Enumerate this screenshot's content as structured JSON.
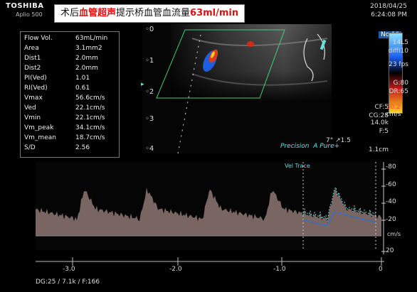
{
  "header": {
    "brand": "TOSHIBA",
    "model": "Aplio 500",
    "banner_prefix": "术后",
    "banner_highlight": "血管超声",
    "banner_middle": "提示桥血管血流量",
    "banner_value": "63ml/min",
    "date": "2018/04/25",
    "time": "6:24:08 PM"
  },
  "measurements": [
    {
      "label": "Flow Vol.",
      "value": "63mL/min"
    },
    {
      "label": "Area",
      "value": "3.1mm2"
    },
    {
      "label": "Dist1",
      "value": "2.0mm"
    },
    {
      "label": "Dist2",
      "value": "2.0mm"
    },
    {
      "label": "PI(Ved)",
      "value": "1.01"
    },
    {
      "label": "RI(Ved)",
      "value": "0.61"
    },
    {
      "label": "Vmax",
      "value": "56.6cm/s"
    },
    {
      "label": "Ved",
      "value": "22.1cm/s"
    },
    {
      "label": "Vmin",
      "value": "22.1cm/s"
    },
    {
      "label": "Vm_peak",
      "value": "34.1cm/s"
    },
    {
      "label": "Vm_mean",
      "value": "18.7cm/s"
    },
    {
      "label": "S/D",
      "value": "2.56"
    }
  ],
  "depth_marks": [
    "0",
    "1",
    "2",
    "3",
    "4"
  ],
  "color_bar": {
    "top": "No.16",
    "bottom_value": "30.2",
    "bottom_unit": "cm/s"
  },
  "params": [
    "14L5",
    "diffI10",
    "23 fps",
    "G:80",
    "DR:65",
    "CF:5",
    "CG:28",
    "14.0k",
    "F:5",
    "1.1cm"
  ],
  "angle": "7°  ↗1.5",
  "precision_text": "Precision",
  "apure_text": "A Pure+",
  "doppler": {
    "label": "Vel Trace",
    "scale": [
      "-80",
      "-60",
      "-40",
      "-20",
      "cm/s",
      "20"
    ],
    "xticks": [
      "-3.0",
      "-2.0",
      "-1.0",
      "0"
    ]
  },
  "footer": "DG:25  / 7.1k   / F:166",
  "colors": {
    "banner_red": "#d11111",
    "trace_cyan": "#6fd6d6",
    "doppler_fill": "#d9b7b0"
  }
}
